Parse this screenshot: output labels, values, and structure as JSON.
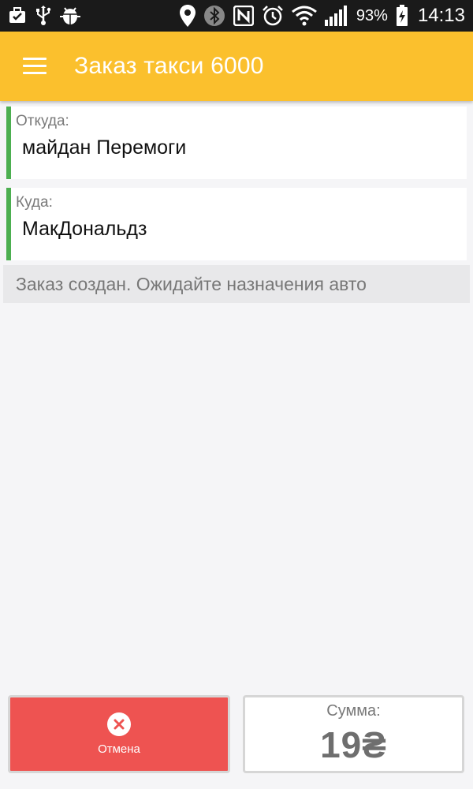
{
  "status_bar": {
    "battery_percent": "93%",
    "time": "14:13",
    "icons_left": [
      "briefcase-check-icon",
      "usb-icon",
      "android-debug-icon"
    ],
    "icons_right": [
      "location-icon",
      "bluetooth-icon",
      "nfc-icon",
      "alarm-icon",
      "wifi-icon",
      "signal-icon",
      "battery-charging-icon"
    ]
  },
  "app_bar": {
    "title": "Заказ такси 6000",
    "menu_icon": "hamburger-menu-icon",
    "color": "#fbc02d"
  },
  "route": {
    "from_label": "Откуда:",
    "from_value": "майдан Перемоги",
    "to_label": "Куда:",
    "to_value": "МакДональдз",
    "accent_color": "#4caf50"
  },
  "status_message": "Заказ создан. Ожидайте назначения авто",
  "cancel_button": {
    "label": "Отмена",
    "icon": "close-circle-icon",
    "color": "#ee5351"
  },
  "sum": {
    "label": "Сумма:",
    "value": "19₴"
  }
}
